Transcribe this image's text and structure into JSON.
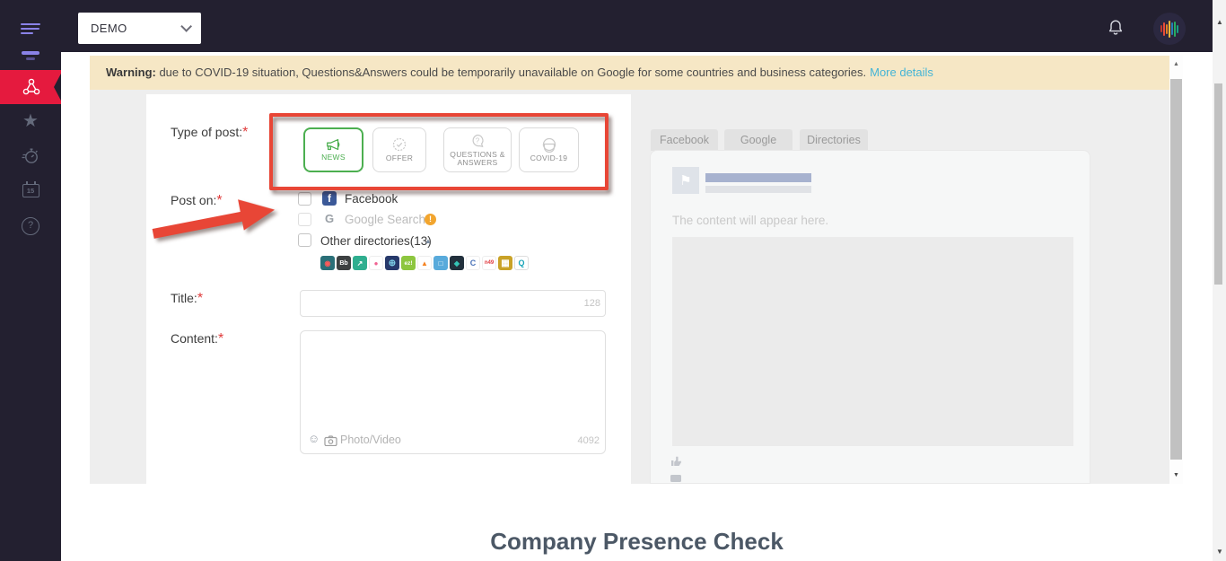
{
  "header": {
    "workspace": "DEMO"
  },
  "banner": {
    "bold": "Warning:",
    "text": " due to COVID-19 situation, Questions&Answers could be temporarily unavailable on Google for some countries and business categories.",
    "link": "More details"
  },
  "form": {
    "type_of_post": {
      "label": "Type of post:",
      "required_mark": "*"
    },
    "post_types": [
      {
        "label": "NEWS",
        "selected": true,
        "accent_color": "#4caf50",
        "icon": "megaphone-icon"
      },
      {
        "label": "OFFER",
        "selected": false,
        "icon": "badge-check-icon"
      },
      {
        "label": "QUESTIONS & ANSWERS",
        "selected": false,
        "icon": "question-bubble-icon"
      },
      {
        "label": "COVID-19",
        "selected": false,
        "icon": "face-mask-icon"
      }
    ],
    "post_on": {
      "label": "Post on:",
      "required_mark": "*"
    },
    "channels": [
      {
        "label": "Facebook",
        "checked": false,
        "disabled": false
      },
      {
        "label": "Google Search",
        "checked": false,
        "disabled": true,
        "has_warning": true,
        "warning_glyph": "!"
      },
      {
        "label": "Other directories(13)",
        "checked": false,
        "expanded": true
      }
    ],
    "directory_icons": [
      {
        "name": "directory-logo-1",
        "glyph": "◉",
        "style": "background:#2a6f78;color:#ff5a5a"
      },
      {
        "name": "directory-logo-2",
        "glyph": "Bb",
        "style": "background:#3d4142;color:#fff;font-size:7px"
      },
      {
        "name": "directory-logo-3",
        "glyph": "↗",
        "style": "background:#2fae8f;color:#fff"
      },
      {
        "name": "directory-logo-4",
        "glyph": "●",
        "style": "background:#fff;color:#f06292;border:1px solid #eee"
      },
      {
        "name": "directory-logo-5",
        "glyph": "⊕",
        "style": "background:#27396b;color:#7fd1e8;font-size:10px"
      },
      {
        "name": "directory-logo-6",
        "glyph": "ez!",
        "style": "background:#8dc63f;color:#fff;font-size:6.5px"
      },
      {
        "name": "directory-logo-7",
        "glyph": "▲",
        "style": "background:#fff;color:#f5821f;border:1px solid #eee"
      },
      {
        "name": "directory-logo-8",
        "glyph": "□",
        "style": "background:#58aadb;color:#fff"
      },
      {
        "name": "directory-logo-9",
        "glyph": "◆",
        "style": "background:#22303c;color:#35c4b5"
      },
      {
        "name": "directory-logo-10",
        "glyph": "C",
        "style": "background:#fff;color:#4a72b8;border:1px solid #eee;font-size:9px"
      },
      {
        "name": "directory-logo-11",
        "glyph": "n49",
        "style": "background:#fff;color:#e03a3e;border:1px solid #eee;font-size:6px"
      },
      {
        "name": "directory-logo-12",
        "glyph": "▦",
        "style": "background:#c9a227;color:#fff;font-size:10px"
      },
      {
        "name": "directory-logo-13",
        "glyph": "Q",
        "style": "background:#fff;color:#19a4b8;border:1px solid #ddd;font-size:9px"
      }
    ],
    "title": {
      "label": "Title:",
      "required_mark": "*",
      "value": "",
      "max_counter": "128"
    },
    "content": {
      "label": "Content:",
      "required_mark": "*",
      "value": "",
      "max_counter": "4092",
      "attach_label": "Photo/Video"
    }
  },
  "preview": {
    "tabs": [
      {
        "label": "Facebook"
      },
      {
        "label": "Google"
      },
      {
        "label": "Directories"
      }
    ],
    "placeholder_text": "The content will appear here."
  },
  "footer": {
    "heading": "Company Presence Check"
  },
  "annotations": {
    "highlight_color": "#e84636",
    "arrow_color": "#e84636"
  },
  "glyphs": {
    "star": "★",
    "calendar_day": "15",
    "collapse_triangle": "▲",
    "smiley": "☺",
    "flag": "⚑",
    "scroll_up": "▲",
    "scroll_down": "▼"
  }
}
